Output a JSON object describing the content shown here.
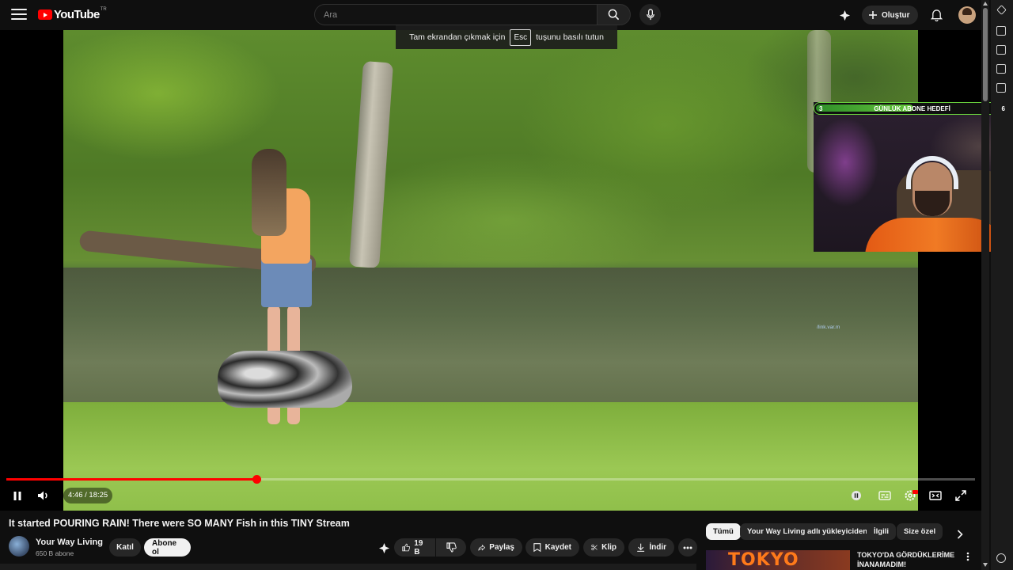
{
  "header": {
    "logo_text": "YouTube",
    "logo_region": "TR",
    "search_placeholder": "Ara",
    "create_label": "Oluştur"
  },
  "toast": {
    "before": "Tam ekrandan çıkmak için",
    "key": "Esc",
    "after": "tuşunu basılı tutun"
  },
  "overlay": {
    "goal_start": "3",
    "goal_label": "GÜNLÜK ABONE HEDEFİ",
    "goal_target": "6",
    "goal_progress": 0.5
  },
  "player": {
    "time_current": "4:46",
    "time_total": "18:25",
    "time_display": "4:46 / 18:25",
    "progress": 0.258,
    "watermark": "/link.var.m"
  },
  "video": {
    "title": "It started POURING RAIN! There were SO MANY Fish in this TINY Stream",
    "channel_name": "Your Way Living",
    "subscribers": "650 B abone",
    "join_label": "Katıl",
    "subscribe_label": "Abone ol",
    "like_count": "19 B",
    "share_label": "Paylaş",
    "save_label": "Kaydet",
    "clip_label": "Klip",
    "download_label": "İndir"
  },
  "chips": [
    {
      "label": "Tümü"
    },
    {
      "label": "Your Way Living adlı yükleyiciden"
    },
    {
      "label": "İlgili"
    },
    {
      "label": "Size özel"
    }
  ],
  "recommendation": {
    "thumb_text": "TOKYO",
    "title": "TOKYO'DA GÖRDÜKLERİME İNANAMADIM!"
  },
  "colors": {
    "accent": "#ff0000",
    "background": "#0f0f0f",
    "goal_green": "#64c43a"
  }
}
